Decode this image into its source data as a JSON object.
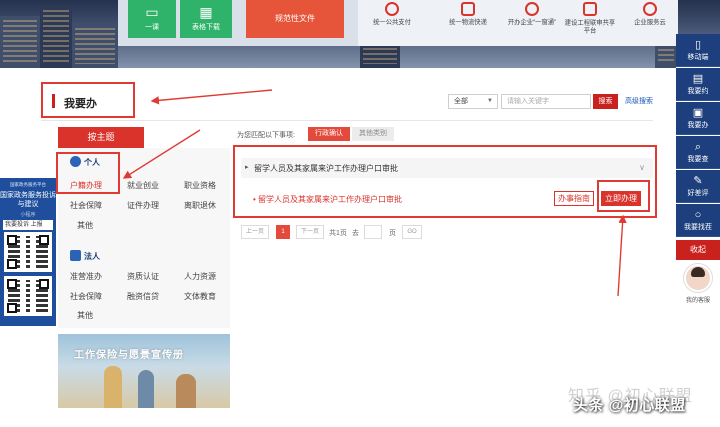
{
  "banner": {
    "tiles": [
      {
        "label": "一课",
        "icon": "classroom-icon"
      },
      {
        "label": "表格下载",
        "icon": "table-download-icon"
      },
      {
        "label": "规范性文件",
        "icon": "document-icon"
      }
    ],
    "services": [
      {
        "label": "统一公共支付"
      },
      {
        "label": "统一物流快递"
      },
      {
        "label": "开办企业“一窗通”"
      },
      {
        "label": "建设工程联审共享平台"
      },
      {
        "label": "企业服务云"
      }
    ]
  },
  "sidebar": {
    "items": [
      {
        "label": "移动端",
        "icon": "mobile-icon"
      },
      {
        "label": "我要约",
        "icon": "calendar-icon"
      },
      {
        "label": "我要办",
        "icon": "task-icon"
      },
      {
        "label": "我要查",
        "icon": "magnifier-doc-icon"
      },
      {
        "label": "好差评",
        "icon": "rating-icon"
      },
      {
        "label": "我要找茬",
        "icon": "search-icon"
      }
    ],
    "collapse_label": "收起",
    "avatar_label": "我的客服"
  },
  "section": {
    "title": "我要办"
  },
  "search": {
    "scope_value": "全部",
    "placeholder": "请输入关键字",
    "button_label": "搜索",
    "advanced_label": "高级搜索"
  },
  "left": {
    "theme_tab": "按主题",
    "personal": {
      "header": "个人",
      "items": [
        "户籍办理",
        "就业创业",
        "职业资格",
        "社会保障",
        "证件办理",
        "离职退休",
        "其他"
      ]
    },
    "corporate": {
      "header": "法人",
      "items": [
        "准营准办",
        "资质认证",
        "人力资源",
        "社会保障",
        "融资信贷",
        "文体教育",
        "其他"
      ]
    },
    "promo_title": "工作保险与愿景宣传册"
  },
  "qr_widget": {
    "top_text": "国家政务服务平台",
    "title": "国家政务服务投诉与建议",
    "sub_text": "小程序",
    "section_label": "我要投诉 上报"
  },
  "matters": {
    "match_label": "为您匹配以下事项:",
    "tabs": [
      {
        "label": "行政确认",
        "active": true
      },
      {
        "label": "其他类别",
        "active": false
      }
    ],
    "item_title": "留学人员及其家属来沪工作办理户口审批",
    "sub_item": "留学人员及其家属来沪工作办理户口审批",
    "guide_label": "办事指南",
    "apply_label": "立即办理"
  },
  "pagination": {
    "prev": "上一页",
    "current": "1",
    "next": "下一页",
    "total_text": "共1页",
    "goto_text": "去",
    "page_text": "页",
    "go_label": "GO"
  },
  "watermark": {
    "zhihu": "知乎 @初心联盟",
    "toutiao": "头条 @初心联盟"
  },
  "colors": {
    "brand_red": "#d9332b",
    "nav_blue": "#1d3f7e",
    "annotation_red": "#e03b32"
  }
}
